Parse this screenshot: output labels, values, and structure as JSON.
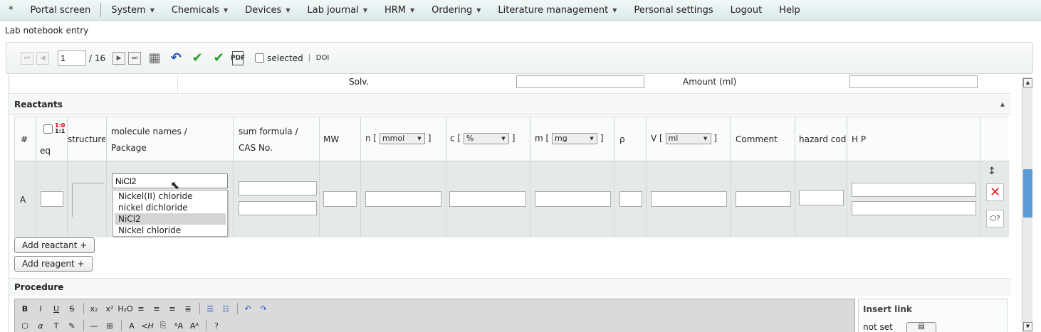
{
  "menu": {
    "star": "*",
    "items": [
      {
        "label": "Portal screen",
        "caret": false
      },
      {
        "label": "System",
        "caret": true
      },
      {
        "label": "Chemicals",
        "caret": true
      },
      {
        "label": "Devices",
        "caret": true
      },
      {
        "label": "Lab journal",
        "caret": true
      },
      {
        "label": "HRM",
        "caret": true
      },
      {
        "label": "Ordering",
        "caret": true
      },
      {
        "label": "Literature management",
        "caret": true
      },
      {
        "label": "Personal settings",
        "caret": false
      },
      {
        "label": "Logout",
        "caret": false
      },
      {
        "label": "Help",
        "caret": false
      }
    ]
  },
  "page_title": "Lab notebook entry",
  "toolbar": {
    "page_value": "1",
    "page_count": "/ 16",
    "selected_label": "selected",
    "doi_label": "DOI"
  },
  "solvent_row": {
    "solv_label": "Solv.",
    "amount_label": "Amount (ml)"
  },
  "reactants": {
    "title": "Reactants",
    "headers": {
      "num": "#",
      "eq": "eq",
      "structure": "structure",
      "names_line1": "molecule names /",
      "names_line2": "Package",
      "formula_line1": "sum formula /",
      "formula_line2": "CAS No.",
      "mw": "MW",
      "n_prefix": "n [",
      "n_unit": "mmol",
      "c_prefix": "c [",
      "c_unit": "%",
      "m_prefix": "m [",
      "m_unit": "mg",
      "rho": "ρ",
      "v_prefix": "V [",
      "v_unit": "ml",
      "bracket_close": "]",
      "comment": "Comment",
      "hazard": "hazard code",
      "hp": "H P"
    },
    "row": {
      "label": "A",
      "name_value": "NiCl2"
    },
    "autocomplete": [
      "Nickel(II) chloride",
      "nickel dichloride",
      "NiCl2",
      "Nickel chloride"
    ],
    "autocomplete_highlight": 2,
    "add_reactant": "Add reactant +",
    "add_reagent": "Add reagent +"
  },
  "procedure": {
    "title": "Procedure",
    "insert_link_title": "Insert link",
    "insert_link_value": "not set"
  },
  "colors": {
    "accent_blue": "#1a4fc4",
    "accent_green": "#22a022",
    "delete_red": "#e02020",
    "scroll_thumb": "#5b9bd5"
  }
}
